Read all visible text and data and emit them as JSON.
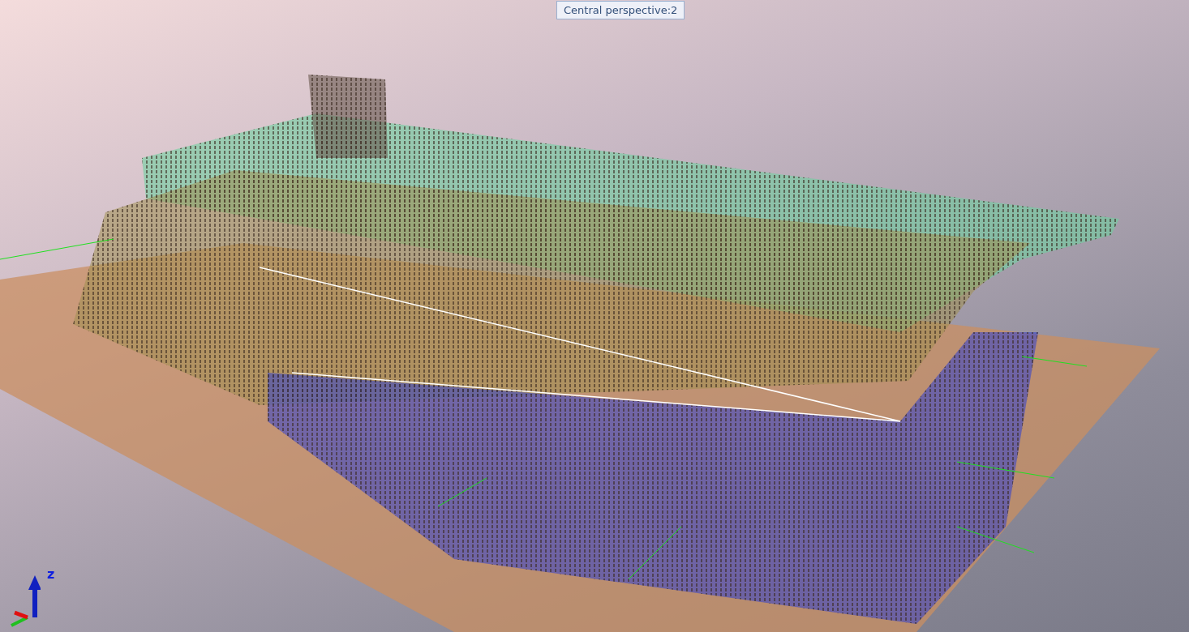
{
  "viewport": {
    "view_label": "Central perspective:2",
    "axis_label": "z"
  }
}
